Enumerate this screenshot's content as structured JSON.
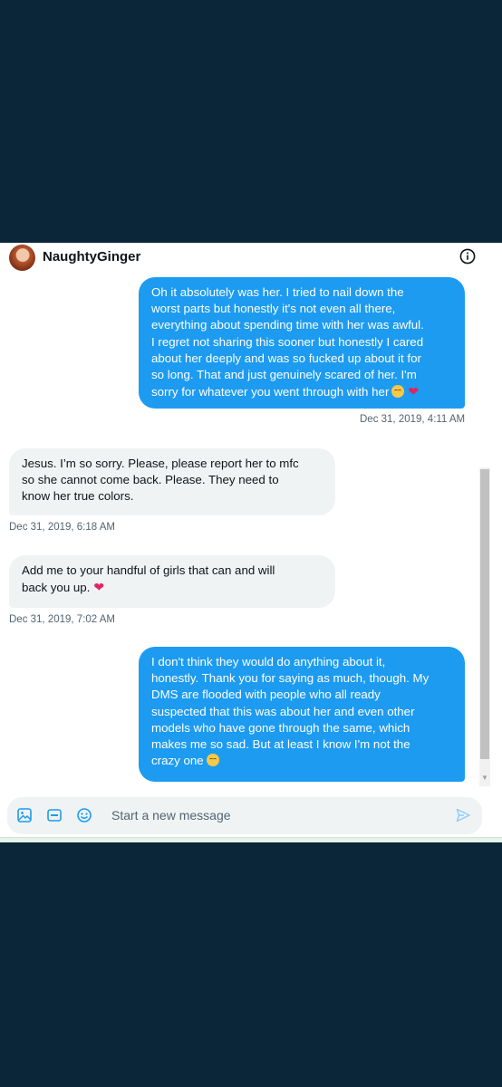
{
  "header": {
    "name": "NaughtyGinger"
  },
  "messages": [
    {
      "dir": "out",
      "text": "Oh it absolutely was her.  I tried to nail down the\nworst parts but honestly it's not even all there,\neverything about spending time with her was awful.\nI regret not sharing this sooner but honestly I cared\nabout her deeply and was so fucked up about it for\nso long.  That and just genuinely scared of her.  I'm\nsorry for whatever you went through with her",
      "time": "Dec 31, 2019, 4:11 AM"
    },
    {
      "dir": "in",
      "text": "Jesus. I’m so sorry. Please, please report her to mfc\nso she cannot come back. Please. They need to\nknow her true colors.",
      "time": "Dec 31, 2019, 6:18 AM"
    },
    {
      "dir": "in",
      "text": "Add me to your handful of girls that can and will\nback you up.",
      "time": "Dec 31, 2019, 7:02 AM"
    },
    {
      "dir": "out",
      "text": "I don't think they would do anything about it,\nhonestly.  Thank you for saying as much, though. My\nDMS are flooded with people who all ready\nsuspected that this was about her and even other\nmodels who have gone through the same, which\nmakes me so sad.  But at least I know I'm not the\ncrazy one",
      "time": ""
    }
  ],
  "composer": {
    "placeholder": "Start a new message"
  },
  "icons": [
    "image-icon",
    "gif-icon",
    "emoji-icon",
    "send-icon",
    "info-icon"
  ],
  "colors": {
    "accent": "#1d9bf0",
    "page_bg": "#0c2639",
    "incoming_bg": "#eff3f4"
  }
}
